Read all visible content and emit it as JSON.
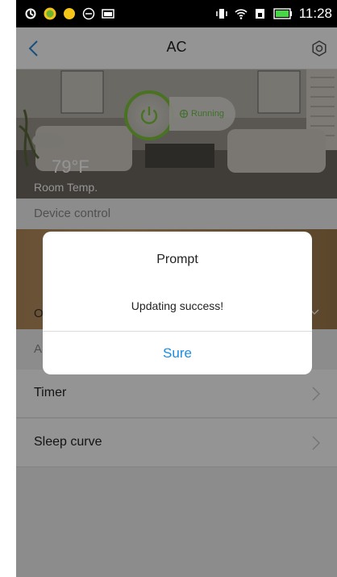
{
  "status_bar": {
    "time": "11:28",
    "left_icons": [
      "sync-icon",
      "app-icon",
      "notification-dot-icon",
      "glasses-icon",
      "image-icon"
    ],
    "right_icons": [
      "vibrate-icon",
      "wifi-icon",
      "sim-icon",
      "battery-icon"
    ]
  },
  "nav": {
    "title": "AC",
    "back_icon": "chevron-left-icon",
    "settings_icon": "gear-icon"
  },
  "hero": {
    "power_state": "Running",
    "temperature": "79°F",
    "temperature_label": "Room Temp."
  },
  "content": {
    "section_title": "Device control",
    "control_strip_label": "O",
    "sub_section_label": "A",
    "rows": [
      {
        "label": "Timer"
      },
      {
        "label": "Sleep curve"
      }
    ]
  },
  "dialog": {
    "title": "Prompt",
    "message": "Updating success!",
    "button_label": "Sure"
  },
  "colors": {
    "accent": "#1a8ce0",
    "power_green": "#7ec43c",
    "running_green": "#6cc14a"
  }
}
